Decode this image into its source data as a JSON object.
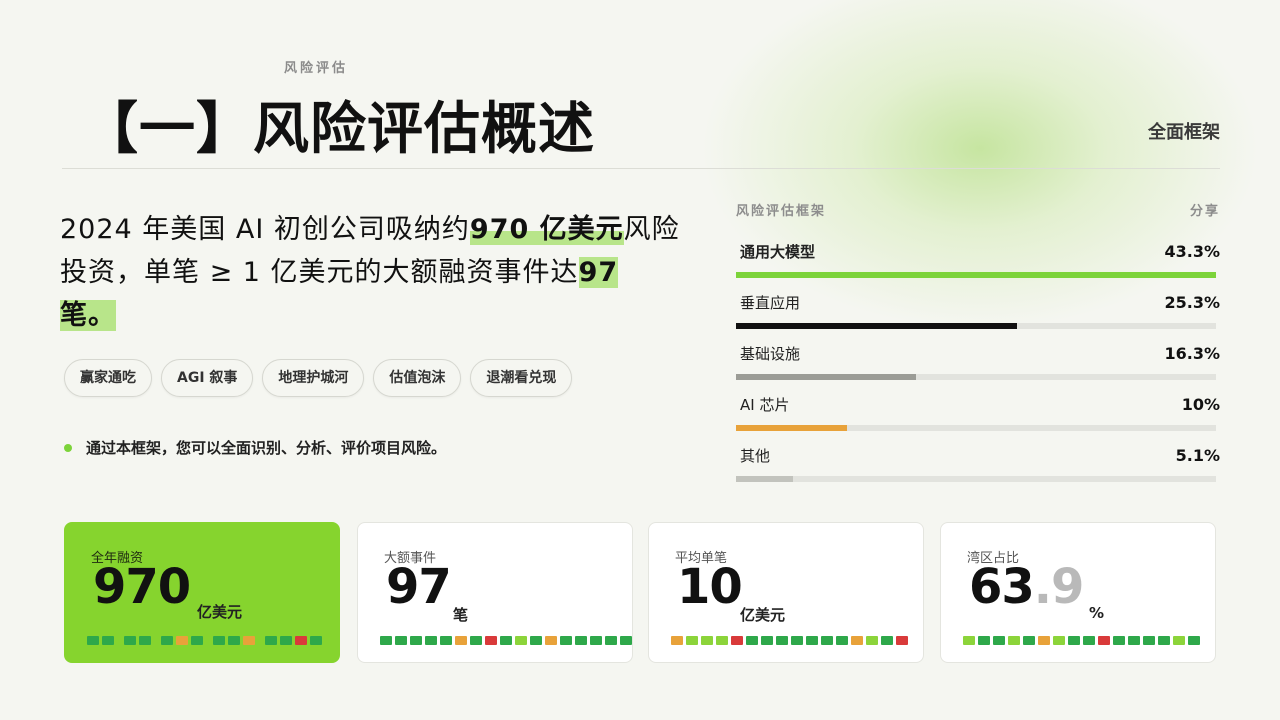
{
  "header": {
    "kicker": "风险评估",
    "title": "【一】风险评估概述",
    "right_label": "全面框架"
  },
  "lead": {
    "part1": "2024 年美国 AI 初创公司吸纳约",
    "highlight1": "970 亿美元",
    "part2": "风险投资，单笔 ≥ 1 亿美元的大额融资事件达",
    "highlight2": "97 笔",
    "part3": "。"
  },
  "tags": [
    "赢家通吃",
    "AGI 叙事",
    "地理护城河",
    "估值泡沫",
    "退潮看兑现"
  ],
  "note": "通过本框架，您可以全面识别、分析、评价项目风险。",
  "panel": {
    "title": "风险评估框架",
    "action": "分享",
    "rows": [
      {
        "label": "通用大模型",
        "value": "43.3%",
        "fraction": 1.0,
        "color": "#7cd33a"
      },
      {
        "label": "垂直应用",
        "value": "25.3%",
        "fraction": 0.585,
        "color": "#111111"
      },
      {
        "label": "基础设施",
        "value": "16.3%",
        "fraction": 0.376,
        "color": "#9b9c96"
      },
      {
        "label": "AI 芯片",
        "value": "10%",
        "fraction": 0.231,
        "color": "#e8a23a"
      },
      {
        "label": "其他",
        "value": "5.1%",
        "fraction": 0.118,
        "color": "#c2c3bd"
      }
    ]
  },
  "cards": [
    {
      "label": "全年融资",
      "value": "970",
      "unit": "亿美元"
    },
    {
      "label": "大额事件",
      "value": "97",
      "unit": "笔"
    },
    {
      "label": "平均单笔",
      "value": "10",
      "unit": "亿美元"
    },
    {
      "label": "湾区占比",
      "value": "63",
      "value_frac": ".9",
      "unit": "%"
    }
  ],
  "colors": {
    "accent": "#86d42e",
    "highlight": "#b8e58a",
    "spark_green": "#2ea84a",
    "spark_lime": "#8cd43a",
    "spark_orange": "#e8a23a",
    "spark_red": "#d93a3a"
  }
}
